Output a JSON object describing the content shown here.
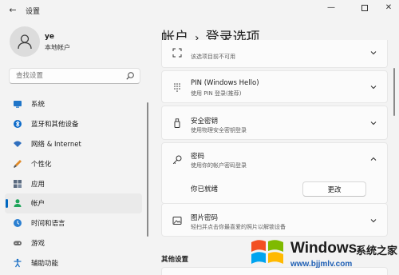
{
  "window": {
    "title": "设置",
    "back_icon": "arrow-left",
    "minimize_glyph": "—",
    "close_glyph": "✕"
  },
  "user": {
    "name": "ye",
    "account_type": "本地帐户"
  },
  "search": {
    "placeholder": "查找设置"
  },
  "nav": {
    "items": [
      {
        "label": "系统",
        "icon": "monitor-icon",
        "active": false
      },
      {
        "label": "蓝牙和其他设备",
        "icon": "bluetooth-icon",
        "active": false
      },
      {
        "label": "网络 & Internet",
        "icon": "wifi-icon",
        "active": false
      },
      {
        "label": "个性化",
        "icon": "brush-icon",
        "active": false
      },
      {
        "label": "应用",
        "icon": "apps-icon",
        "active": false
      },
      {
        "label": "帐户",
        "icon": "person-icon",
        "active": true
      },
      {
        "label": "时间和语言",
        "icon": "globe-clock-icon",
        "active": false
      },
      {
        "label": "游戏",
        "icon": "gamepad-icon",
        "active": false
      },
      {
        "label": "辅助功能",
        "icon": "accessibility-icon",
        "active": false
      }
    ]
  },
  "breadcrumb": {
    "parent": "帐户",
    "separator": "›",
    "current": "登录选项"
  },
  "sign_in_options": [
    {
      "title": "",
      "subtitle": "该选项目前不可用",
      "icon": "face-icon",
      "expanded": false
    },
    {
      "title": "PIN (Windows Hello)",
      "subtitle": "使用 PIN 登录(推荐)",
      "icon": "keypad-icon",
      "expanded": false
    },
    {
      "title": "安全密钥",
      "subtitle": "使用物理安全密钥登录",
      "icon": "usb-key-icon",
      "expanded": false
    },
    {
      "title": "密码",
      "subtitle": "使用你的帐户密码登录",
      "icon": "key-icon",
      "expanded": true
    },
    {
      "title": "图片密码",
      "subtitle": "轻扫并点击你最喜爱的照片以解锁设备",
      "icon": "picture-icon",
      "expanded": false
    }
  ],
  "password_detail": {
    "status": "你已就绪",
    "change_button": "更改"
  },
  "other_settings": {
    "title": "其他设置"
  },
  "watermark": {
    "brand": "Windows",
    "cn": "系统之家",
    "url": "www.bjjmlv.com",
    "colors": [
      "#f25022",
      "#7fba00",
      "#00a4ef",
      "#ffb900"
    ]
  },
  "colors": {
    "accent": "#0067c0",
    "background": "#f3f3f3",
    "card": "#fbfbfb"
  }
}
